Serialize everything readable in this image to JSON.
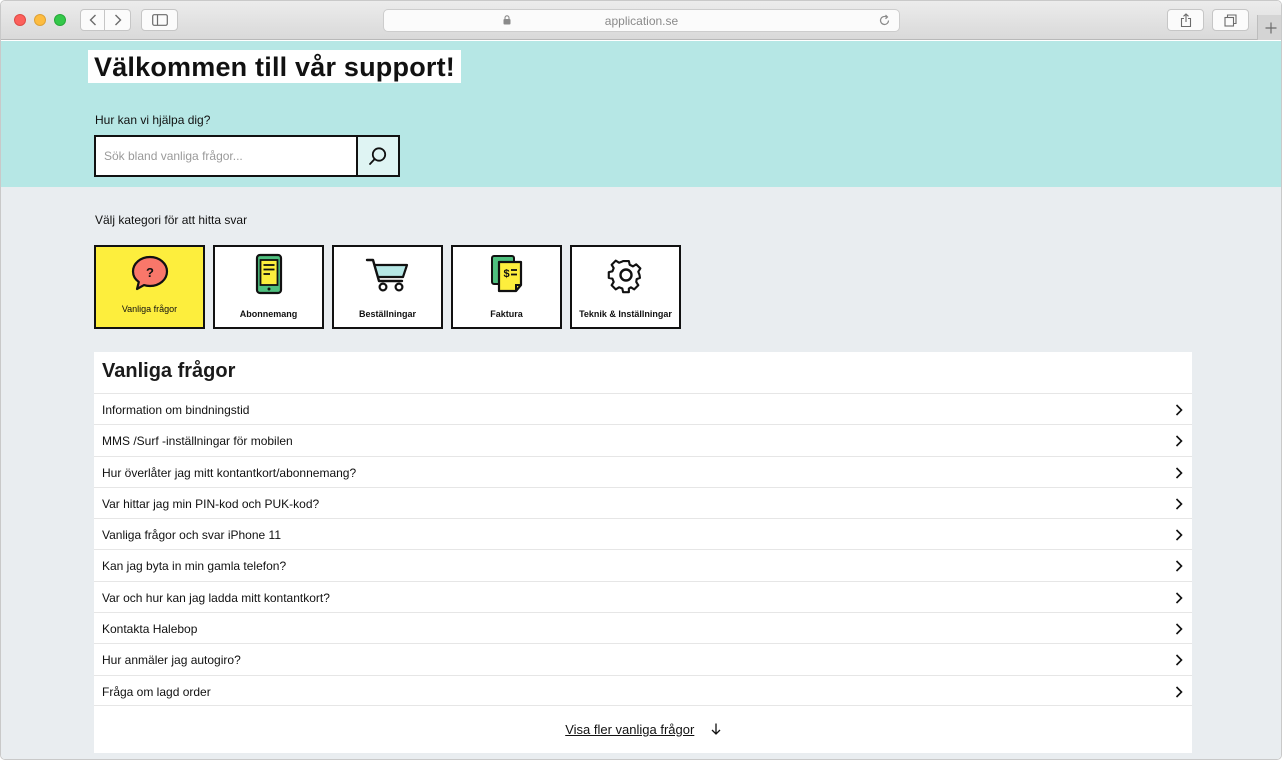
{
  "browser": {
    "url": "application.se"
  },
  "hero": {
    "title": "Välkommen till vår support!",
    "help_label": "Hur kan vi hjälpa dig?",
    "search_placeholder": "Sök bland vanliga frågor..."
  },
  "categories": {
    "label": "Välj kategori för att hitta svar",
    "items": [
      {
        "label": "Vanliga frågor",
        "icon": "question-bubble-icon",
        "active": true
      },
      {
        "label": "Abonnemang",
        "icon": "phone-icon",
        "active": false
      },
      {
        "label": "Beställningar",
        "icon": "cart-icon",
        "active": false
      },
      {
        "label": "Faktura",
        "icon": "invoice-icon",
        "active": false
      },
      {
        "label": "Teknik & Inställningar",
        "icon": "gear-icon",
        "active": false
      }
    ]
  },
  "faq": {
    "title": "Vanliga frågor",
    "items": [
      "Information om bindningstid",
      "MMS /Surf -inställningar för mobilen",
      "Hur överlåter jag mitt kontantkort/abonnemang?",
      "Var hittar jag min PIN-kod och PUK-kod?",
      "Vanliga frågor och svar iPhone 11",
      "Kan jag byta in min gamla telefon?",
      "Var och hur kan jag ladda mitt kontantkort?",
      "Kontakta Halebop",
      "Hur anmäler jag autogiro?",
      "Fråga om lagd order"
    ],
    "more_label": "Visa fler vanliga frågor"
  },
  "colors": {
    "hero_bg": "#b6e7e5",
    "page_bg": "#e9edf0",
    "active_category": "#fdee3d"
  }
}
